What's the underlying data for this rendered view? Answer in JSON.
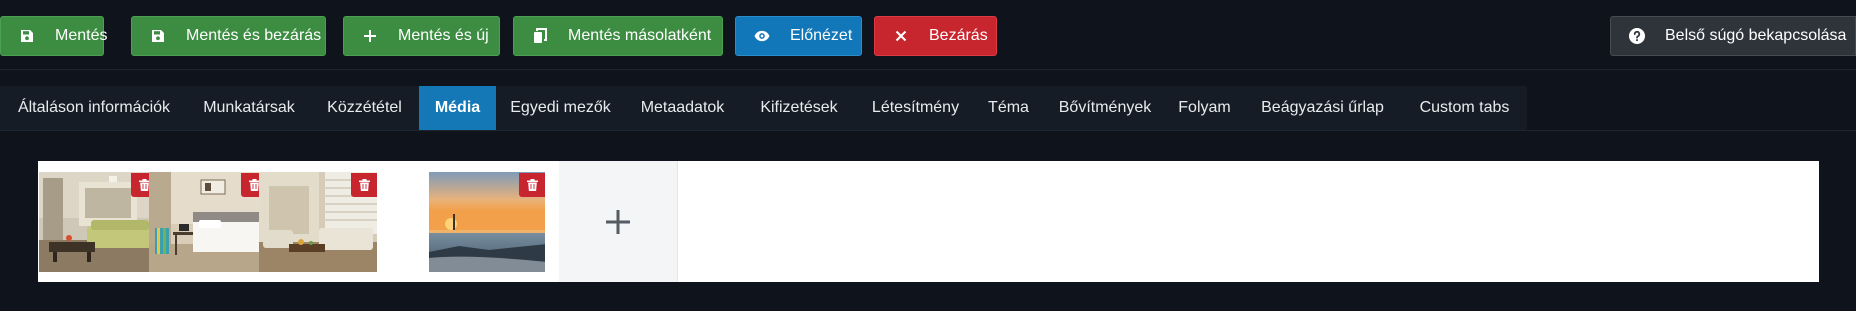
{
  "toolbar": {
    "buttons": [
      {
        "label": "Mentés",
        "icon": "save-icon",
        "color": "#3c8d42"
      },
      {
        "label": "Mentés és bezárás",
        "icon": "save-icon",
        "color": "#3c8d42"
      },
      {
        "label": "Mentés és új",
        "icon": "plus-icon",
        "color": "#3c8d42"
      },
      {
        "label": "Mentés másolatként",
        "icon": "copy-icon",
        "color": "#3c8d42"
      },
      {
        "label": "Előnézet",
        "icon": "eye-icon",
        "color": "#1177b8"
      },
      {
        "label": "Bezárás",
        "icon": "close-icon",
        "color": "#c8262e"
      }
    ],
    "help_button": {
      "label": "Belső súgó bekapcsolása",
      "icon": "question-circle-icon",
      "color": "#2f343b"
    }
  },
  "tabs": [
    {
      "label": "Általáson információk",
      "active": false
    },
    {
      "label": "Munkatársak",
      "active": false
    },
    {
      "label": "Közzététel",
      "active": false
    },
    {
      "label": "Média",
      "active": true
    },
    {
      "label": "Egyedi mezők",
      "active": false
    },
    {
      "label": "Metaadatok",
      "active": false
    },
    {
      "label": "Kifizetések",
      "active": false
    },
    {
      "label": "Létesítmény",
      "active": false
    },
    {
      "label": "Téma",
      "active": false
    },
    {
      "label": "Bővítmények",
      "active": false
    },
    {
      "label": "Folyam",
      "active": false
    },
    {
      "label": "Beágyazási űrlap",
      "active": false
    },
    {
      "label": "Custom tabs",
      "active": false
    }
  ],
  "media": {
    "images": [
      {
        "subject": "living-room-photo"
      },
      {
        "subject": "bedroom-photo"
      },
      {
        "subject": "lounge-photo"
      },
      {
        "subject": "sunset-sea-photo"
      }
    ],
    "delete_icon": "trash-icon",
    "add_icon": "plus-icon"
  },
  "colors": {
    "background": "#0f141c",
    "success": "#3c8d42",
    "primary": "#1177b8",
    "danger": "#c8262e",
    "tab_active": "#1578b6"
  }
}
